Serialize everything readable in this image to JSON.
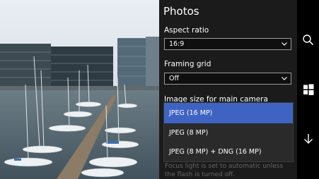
{
  "panel": {
    "title": "Photos",
    "aspect_ratio": {
      "label": "Aspect ratio",
      "value": "16:9"
    },
    "framing_grid": {
      "label": "Framing grid",
      "value": "Off"
    },
    "image_size": {
      "label": "Image size for main camera",
      "options": [
        "JPEG (16 MP)",
        "JPEG (8 MP)",
        "JPEG (8 MP) + DNG (16 MP)"
      ],
      "selected": "JPEG (16 MP)"
    },
    "footnote": "Focus light is set to automatic unless the flash is turned off."
  },
  "appbar": {
    "icons": [
      "search-icon",
      "windows-icon",
      "back-arrow-icon"
    ]
  },
  "colors": {
    "accent": "#3f63c2",
    "panel_bg": "#1b1b1b"
  }
}
